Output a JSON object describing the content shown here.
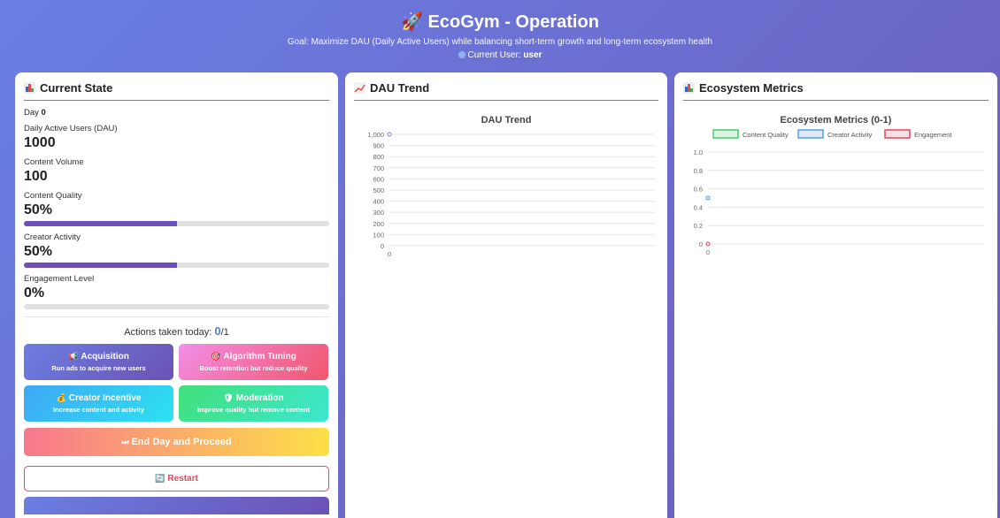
{
  "header": {
    "title": "🚀 EcoGym - Operation",
    "goal": "Goal: Maximize DAU (Daily Active Users) while balancing short-term growth and long-term ecosystem health",
    "user_label": "Current User:",
    "user_name": "user"
  },
  "state": {
    "title": "Current State",
    "day_label": "Day",
    "day_value": "0",
    "dau_label": "Daily Active Users (DAU)",
    "dau_value": "1000",
    "volume_label": "Content Volume",
    "volume_value": "100",
    "quality_label": "Content Quality",
    "quality_value": "50%",
    "quality_fraction": 0.5,
    "creator_label": "Creator Activity",
    "creator_value": "50%",
    "creator_fraction": 0.5,
    "engagement_label": "Engagement Level",
    "engagement_value": "0%",
    "engagement_fraction": 0.0,
    "actions_prefix": "Actions taken today:",
    "actions_taken": "0",
    "actions_total": "/1"
  },
  "actions": {
    "acquisition": {
      "title": "Acquisition",
      "subtitle": "Run ads to acquire new users"
    },
    "algorithm": {
      "title": "Algorithm Tuning",
      "subtitle": "Boost retention but reduce quality"
    },
    "creator": {
      "title": "Creator Incentive",
      "subtitle": "Increase content and activity"
    },
    "moderation": {
      "title": "Moderation",
      "subtitle": "Improve quality but remove content"
    },
    "end_day": "End Day and Proceed",
    "restart": "Restart"
  },
  "panels": {
    "dau_trend_title": "DAU Trend",
    "metrics_title": "Ecosystem Metrics"
  },
  "colors": {
    "accent": "#5a78df",
    "content_quality": "#4cc870",
    "creator_activity": "#57a0e6",
    "engagement": "#e8455c"
  },
  "chart_data": [
    {
      "type": "line",
      "title": "DAU Trend",
      "x": [
        0
      ],
      "series": [
        {
          "values": [
            1000
          ]
        }
      ],
      "ylim": [
        0,
        1000
      ],
      "y_ticks": [
        "1,000",
        "900",
        "800",
        "700",
        "600",
        "500",
        "400",
        "300",
        "200",
        "100",
        "0"
      ],
      "x_ticks": [
        "0"
      ],
      "grid": true
    },
    {
      "type": "line",
      "title": "Ecosystem Metrics (0-1)",
      "x": [
        0
      ],
      "series": [
        {
          "name": "Content Quality",
          "values": [
            0.5
          ]
        },
        {
          "name": "Creator Activity",
          "values": [
            0.5
          ]
        },
        {
          "name": "Engagement",
          "values": [
            0.0
          ]
        }
      ],
      "ylim": [
        0,
        1
      ],
      "y_ticks": [
        "1.0",
        "0.8",
        "0.6",
        "0.4",
        "0.2",
        "0"
      ],
      "x_ticks": [
        "0"
      ],
      "legend": "top",
      "grid": true
    }
  ]
}
